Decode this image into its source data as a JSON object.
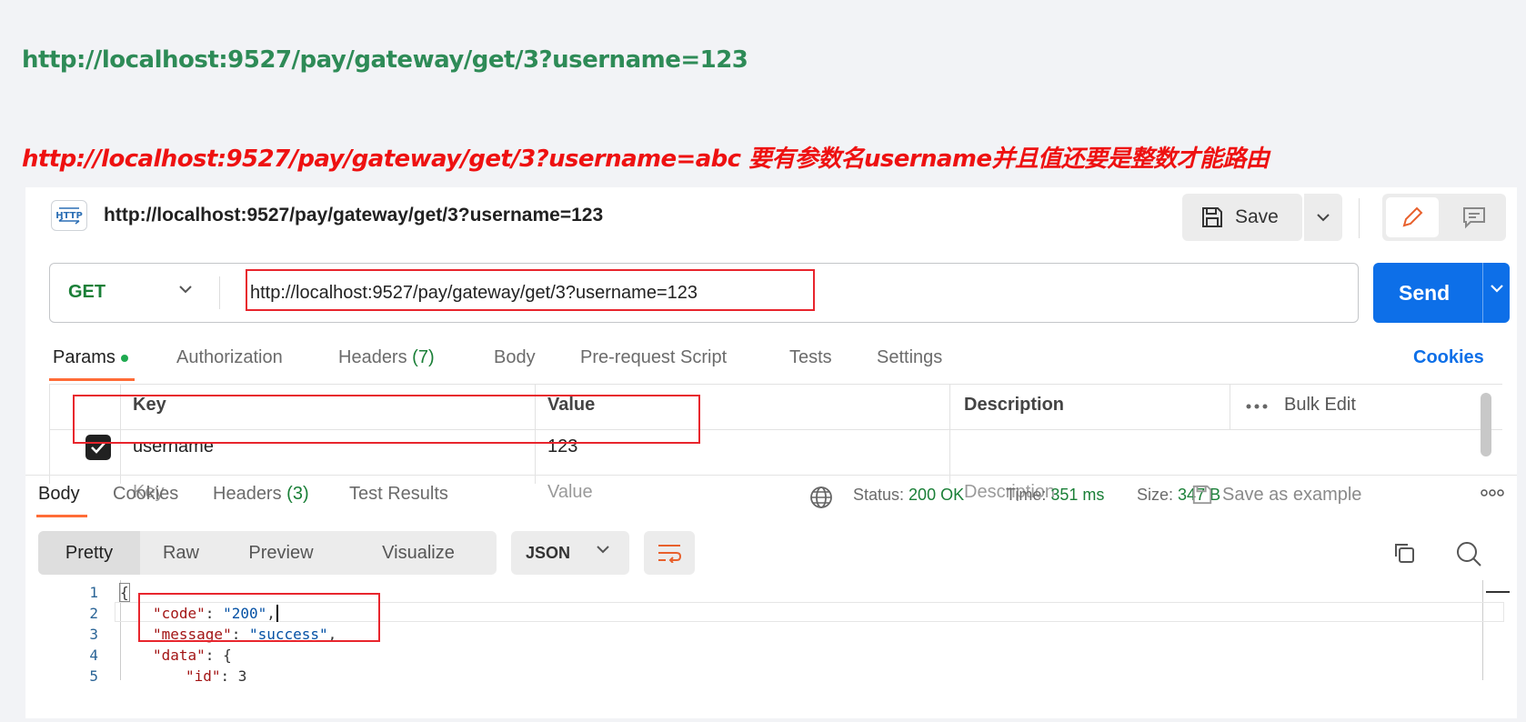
{
  "notes": {
    "line1": "http://localhost:9527/pay/gateway/get/3?username=123",
    "line2": "http://localhost:9527/pay/gateway/get/3?username=abc 要有参数名username并且值还要是整数才能路由"
  },
  "header": {
    "badge": "HTTP",
    "title": "http://localhost:9527/pay/gateway/get/3?username=123",
    "save_label": "Save"
  },
  "request": {
    "method": "GET",
    "url": "http://localhost:9527/pay/gateway/get/3?username=123",
    "send_label": "Send"
  },
  "request_tabs": {
    "params": "Params",
    "authorization": "Authorization",
    "headers": "Headers",
    "headers_count": "(7)",
    "body": "Body",
    "prerequest": "Pre-request Script",
    "tests": "Tests",
    "settings": "Settings",
    "cookies": "Cookies"
  },
  "params_table": {
    "col_key": "Key",
    "col_value": "Value",
    "col_description": "Description",
    "bulk_edit": "Bulk Edit",
    "rows": [
      {
        "key": "username",
        "value": "123",
        "description": "",
        "checked": true
      }
    ],
    "placeholder_key": "Key",
    "placeholder_value": "Value",
    "placeholder_description": "Description"
  },
  "response_tabs": {
    "body": "Body",
    "cookies": "Cookies",
    "headers": "Headers",
    "headers_count": "(3)",
    "test_results": "Test Results"
  },
  "response_meta": {
    "status_label": "Status:",
    "status_value": "200 OK",
    "time_label": "Time:",
    "time_value": "351 ms",
    "size_label": "Size:",
    "size_value": "347 B",
    "save_example": "Save as example"
  },
  "format": {
    "pretty": "Pretty",
    "raw": "Raw",
    "preview": "Preview",
    "visualize": "Visualize",
    "language": "JSON"
  },
  "code": {
    "line_numbers": [
      "1",
      "2",
      "3",
      "4",
      "5"
    ],
    "l1": "{",
    "l2_key": "\"code\"",
    "l2_val": "\"200\"",
    "l3_key": "\"message\"",
    "l3_val": "\"success\"",
    "l4_key": "\"data\"",
    "l4_rest": ": {",
    "l5_key": "\"id\"",
    "l5_rest": ": 3"
  },
  "colors": {
    "accent_orange": "#ff6c37",
    "send_blue": "#0d6fe8",
    "status_green": "#1a7f37",
    "highlight_red": "#e8252d"
  }
}
